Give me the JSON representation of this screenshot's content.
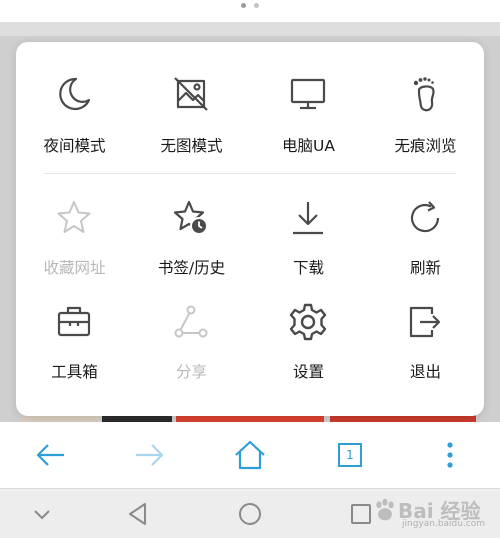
{
  "menu": {
    "row1": [
      {
        "label": "夜间模式",
        "icon": "moon-icon",
        "enabled": true
      },
      {
        "label": "无图模式",
        "icon": "no-image-icon",
        "enabled": true
      },
      {
        "label": "电脑UA",
        "icon": "monitor-icon",
        "enabled": true
      },
      {
        "label": "无痕浏览",
        "icon": "footprint-icon",
        "enabled": true
      }
    ],
    "row2": [
      {
        "label": "收藏网址",
        "icon": "star-icon",
        "enabled": false
      },
      {
        "label": "书签/历史",
        "icon": "star-clock-icon",
        "enabled": true
      },
      {
        "label": "下载",
        "icon": "download-icon",
        "enabled": true
      },
      {
        "label": "刷新",
        "icon": "refresh-icon",
        "enabled": true
      }
    ],
    "row3": [
      {
        "label": "工具箱",
        "icon": "toolbox-icon",
        "enabled": true
      },
      {
        "label": "分享",
        "icon": "share-icon",
        "enabled": false
      },
      {
        "label": "设置",
        "icon": "gear-icon",
        "enabled": true
      },
      {
        "label": "退出",
        "icon": "exit-icon",
        "enabled": true
      }
    ]
  },
  "bottom_bar": {
    "tab_count": "1",
    "accent_color": "#2f9ed6",
    "disabled_color": "#a9d6ef",
    "icons": [
      "back-arrow-icon",
      "forward-arrow-icon",
      "home-icon",
      "tabs-icon",
      "more-vertical-icon"
    ]
  },
  "system_nav": {
    "icons": [
      "chevron-down-icon",
      "back-triangle-icon",
      "home-circle-icon",
      "recents-square-icon"
    ]
  },
  "watermark": {
    "text": "Bai 经验",
    "url": "jingyan.baidu.com"
  },
  "colors": {
    "icon_dark": "#4a4a4a",
    "icon_disabled": "#c6c6c6",
    "label_dark": "#1a1a1a",
    "label_disabled": "#b9b9b9"
  }
}
